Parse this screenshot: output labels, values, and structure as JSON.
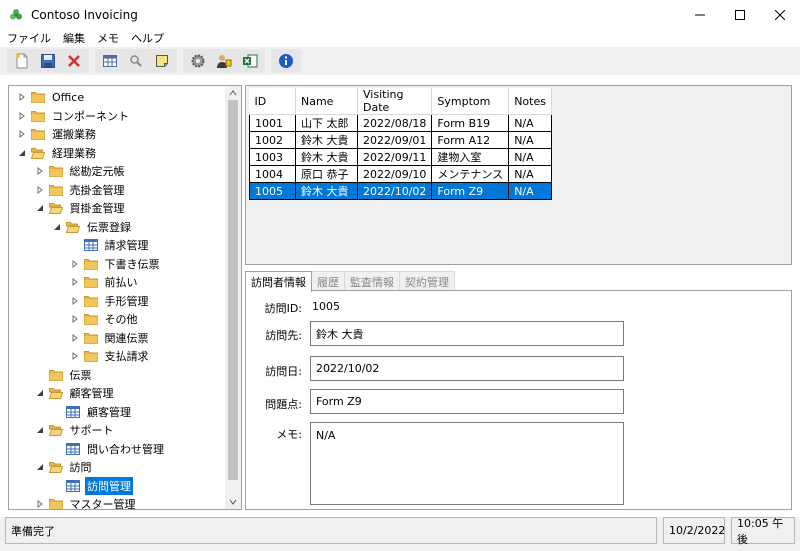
{
  "window": {
    "title": "Contoso Invoicing"
  },
  "menu": [
    "ファイル",
    "編集",
    "メモ",
    "ヘルプ"
  ],
  "toolbar": {
    "groups": [
      [
        "new-document-icon",
        "save-icon",
        "delete-icon"
      ],
      [
        "table-icon",
        "search-icon",
        "note-icon"
      ],
      [
        "settings-icon",
        "user-icon",
        "excel-icon"
      ],
      [
        "info-icon"
      ]
    ]
  },
  "tree": [
    {
      "label": "Office",
      "level": 0,
      "expander": "collapsed",
      "icon": "folder"
    },
    {
      "label": "コンポーネント",
      "level": 0,
      "expander": "collapsed",
      "icon": "folder"
    },
    {
      "label": "運搬業務",
      "level": 0,
      "expander": "collapsed",
      "icon": "folder"
    },
    {
      "label": "経理業務",
      "level": 0,
      "expander": "expanded",
      "icon": "folder-open"
    },
    {
      "label": "総勘定元帳",
      "level": 1,
      "expander": "collapsed",
      "icon": "folder"
    },
    {
      "label": "売掛金管理",
      "level": 1,
      "expander": "collapsed",
      "icon": "folder"
    },
    {
      "label": "買掛金管理",
      "level": 1,
      "expander": "expanded",
      "icon": "folder-open"
    },
    {
      "label": "伝票登録",
      "level": 2,
      "expander": "expanded",
      "icon": "folder-open"
    },
    {
      "label": "請求管理",
      "level": 3,
      "expander": "none",
      "icon": "table"
    },
    {
      "label": "下書き伝票",
      "level": 3,
      "expander": "collapsed",
      "icon": "folder"
    },
    {
      "label": "前払い",
      "level": 3,
      "expander": "collapsed",
      "icon": "folder"
    },
    {
      "label": "手形管理",
      "level": 3,
      "expander": "collapsed",
      "icon": "folder"
    },
    {
      "label": "その他",
      "level": 3,
      "expander": "collapsed",
      "icon": "folder"
    },
    {
      "label": "関連伝票",
      "level": 3,
      "expander": "collapsed",
      "icon": "folder"
    },
    {
      "label": "支払請求",
      "level": 3,
      "expander": "collapsed",
      "icon": "folder"
    },
    {
      "label": "伝票",
      "level": 1,
      "expander": "none",
      "icon": "folder"
    },
    {
      "label": "顧客管理",
      "level": 1,
      "expander": "expanded",
      "icon": "folder-open"
    },
    {
      "label": "顧客管理",
      "level": 2,
      "expander": "none",
      "icon": "table"
    },
    {
      "label": "サポート",
      "level": 1,
      "expander": "expanded",
      "icon": "folder-open"
    },
    {
      "label": "問い合わせ管理",
      "level": 2,
      "expander": "none",
      "icon": "table"
    },
    {
      "label": "訪問",
      "level": 1,
      "expander": "expanded",
      "icon": "folder-open"
    },
    {
      "label": "訪問管理",
      "level": 2,
      "expander": "none",
      "icon": "table",
      "selected": true
    },
    {
      "label": "マスター管理",
      "level": 1,
      "expander": "collapsed",
      "icon": "folder"
    }
  ],
  "grid": {
    "columns": [
      "ID",
      "Name",
      "Visiting Date",
      "Symptom",
      "Notes"
    ],
    "rows": [
      [
        "1001",
        "山下 太郎",
        "2022/08/18",
        "Form B19",
        "N/A"
      ],
      [
        "1002",
        "鈴木 大貴",
        "2022/09/01",
        "Form A12",
        "N/A"
      ],
      [
        "1003",
        "鈴木 大貴",
        "2022/09/11",
        "建物入室",
        "N/A"
      ],
      [
        "1004",
        "原口 恭子",
        "2022/09/10",
        "メンテナンス",
        "N/A"
      ],
      [
        "1005",
        "鈴木 大貴",
        "2022/10/02",
        "Form Z9",
        "N/A"
      ]
    ],
    "selected_row": 4
  },
  "tabs": [
    {
      "label": "訪問者情報",
      "active": true
    },
    {
      "label": "履歴",
      "active": false
    },
    {
      "label": "監査情報",
      "active": false
    },
    {
      "label": "契約管理",
      "active": false
    }
  ],
  "form": {
    "id_label": "訪問ID:",
    "id_value": "1005",
    "visit_to_label": "訪問先:",
    "visit_to_value": "鈴木 大貴",
    "visit_date_label": "訪問日:",
    "visit_date_value": "2022/10/02",
    "issue_label": "問題点:",
    "issue_value": "Form Z9",
    "memo_label": "メモ:",
    "memo_value": "N/A"
  },
  "status": {
    "message": "準備完了",
    "date": "10/2/2022",
    "time": "10:05 午後"
  }
}
